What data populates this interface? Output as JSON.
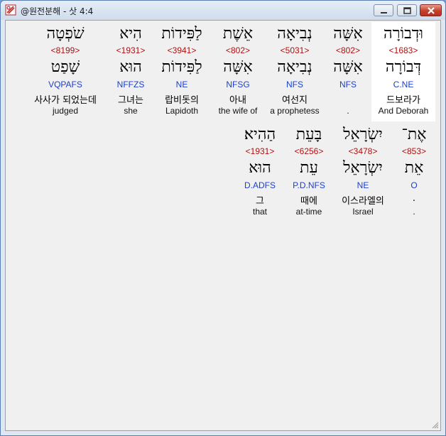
{
  "window": {
    "title": "@원전분해 - 삿 4:4"
  },
  "row1": [
    {
      "heb": "וּדְבוֹרָה",
      "strong": "<1683>",
      "lemma": "דְּבוֹרָה",
      "morph": "C.NE",
      "kor": "드보라가",
      "eng": "And Deborah",
      "highlight": true
    },
    {
      "heb": "אִשָּׁה",
      "strong": "<802>",
      "lemma": "אִשָּׁה",
      "morph": "NFS",
      "kor": "",
      "eng": "."
    },
    {
      "heb": "נְבִיאָה",
      "strong": "<5031>",
      "lemma": "נְבִיאָה",
      "morph": "NFS",
      "kor": "여선지",
      "eng": "a prophetess"
    },
    {
      "heb": "אֵשֶׁת",
      "strong": "<802>",
      "lemma": "אִשָּׁה",
      "morph": "NFSG",
      "kor": "아내",
      "eng": "the wife of"
    },
    {
      "heb": "לַפִּידוֹת",
      "strong": "<3941>",
      "lemma": "לַפִּידוֹת",
      "morph": "NE",
      "kor": "랍비돗의",
      "eng": "Lapidoth"
    },
    {
      "heb": "הִיא",
      "strong": "<1931>",
      "lemma": "הוּא",
      "morph": "NFFZS",
      "kor": "그녀는",
      "eng": "she"
    },
    {
      "heb": "שֹׁפְטָה",
      "strong": "<8199>",
      "lemma": "שָׁפַט",
      "morph": "VQPAFS",
      "kor": "사사가 되었는데",
      "eng": "judged"
    }
  ],
  "row2": [
    {
      "heb": "אֶת־",
      "strong": "<853>",
      "lemma": "אֵת",
      "morph": "O",
      "kor": ".",
      "eng": "."
    },
    {
      "heb": "יִשְׂרָאֵל",
      "strong": "<3478>",
      "lemma": "יִשְׂרָאֵל",
      "morph": "NE",
      "kor": "이스라엘의",
      "eng": "Israel"
    },
    {
      "heb": "בָּעֵת",
      "strong": "<6256>",
      "lemma": "עֵת",
      "morph": "P.D.NFS",
      "kor": "때에",
      "eng": "at-time"
    },
    {
      "heb": "הַהִיא׃",
      "strong": "<1931>",
      "lemma": "הוּא",
      "morph": "D.ADFS",
      "kor": "그",
      "eng": "that"
    }
  ]
}
